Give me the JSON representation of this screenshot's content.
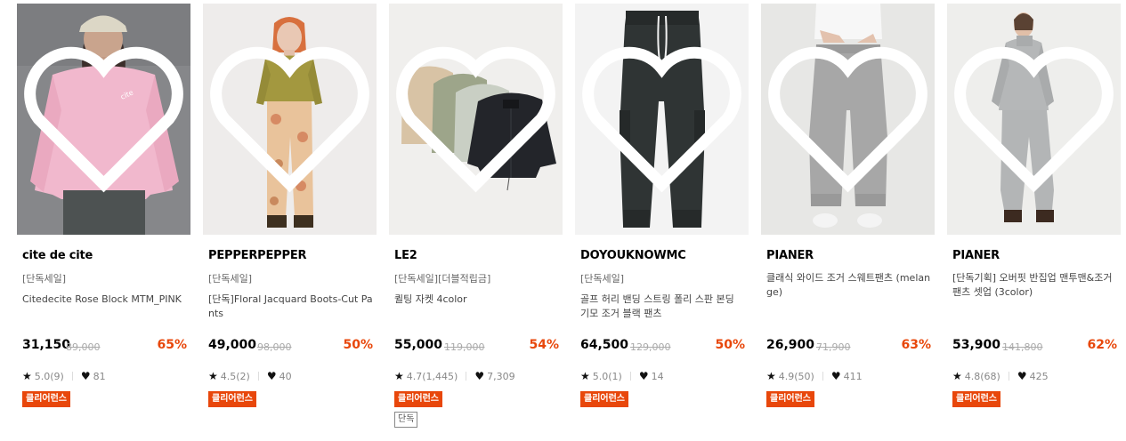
{
  "products": [
    {
      "brand": "cite de cite",
      "subtitle": "[단독세일]",
      "name": "Citedecite Rose Block MTM_PINK",
      "price": "31,150",
      "original_price": "89,000",
      "discount": "65%",
      "rating": "5.0(9)",
      "likes": "81",
      "badge": "클리어런스",
      "image": "pink-sweatshirt-model-photo"
    },
    {
      "brand": "PEPPERPEPPER",
      "subtitle": "[단독세일]",
      "name": "[단독]Floral Jacquard Boots-Cut Pants",
      "price": "49,000",
      "original_price": "98,000",
      "discount": "50%",
      "rating": "4.5(2)",
      "likes": "40",
      "badge": "클리어런스",
      "image": "floral-bootcut-pants-model-photo"
    },
    {
      "brand": "LE2",
      "subtitle": "[단독세일][더블적립금]",
      "name": "퀼팅 자켓 4color",
      "price": "55,000",
      "original_price": "119,000",
      "discount": "54%",
      "rating": "4.7(1,445)",
      "likes": "7,309",
      "badge": "클리어런스",
      "badge2": "단독",
      "image": "quilted-jackets-photo"
    },
    {
      "brand": "DOYOUKNOWMC",
      "subtitle": "[단독세일]",
      "name": "골프 허리 밴딩 스트링 폴리 스판 본딩 기모 조거 블랙 팬츠",
      "price": "64,500",
      "original_price": "129,000",
      "discount": "50%",
      "rating": "5.0(1)",
      "likes": "14",
      "badge": "클리어런스",
      "image": "black-jogger-pants-photo"
    },
    {
      "brand": "PIANER",
      "subtitle": "",
      "name": "클래식 와이드 조거 스웨트팬츠 (melange)",
      "price": "26,900",
      "original_price": "71,900",
      "discount": "63%",
      "rating": "4.9(50)",
      "likes": "411",
      "badge": "클리어런스",
      "image": "grey-sweatpants-model-photo"
    },
    {
      "brand": "PIANER",
      "subtitle": "",
      "name": "[단독기획] 오버핏 반집업 맨투맨&조거팬츠 셋업 (3color)",
      "price": "53,900",
      "original_price": "141,800",
      "discount": "62%",
      "rating": "4.8(68)",
      "likes": "425",
      "badge": "클리어런스",
      "image": "grey-halfzip-set-model-photo"
    }
  ],
  "icons": {
    "wishlist": "heart-outline-icon",
    "rating": "star-icon",
    "likes": "heart-filled-icon"
  },
  "colors": {
    "discount": "#e8470b",
    "badge": "#e8470b"
  }
}
